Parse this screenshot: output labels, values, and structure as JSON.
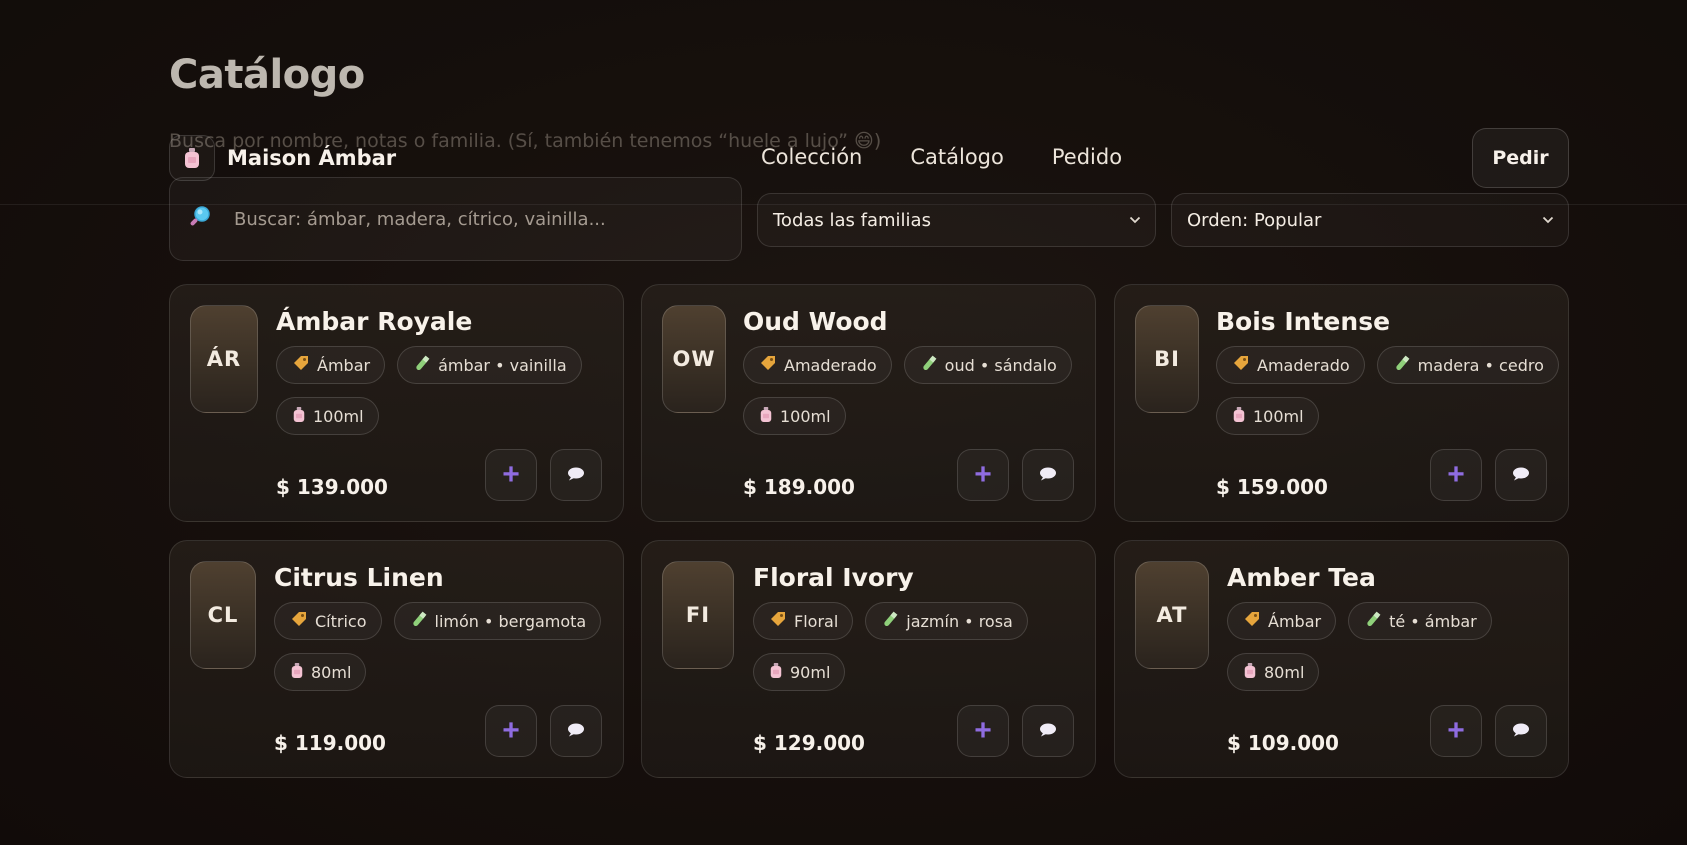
{
  "page": {
    "title": "Catálogo",
    "subtitle": "Busca por nombre, notas o familia. (Sí, también tenemos “huele a lujo” 😄)"
  },
  "nav": {
    "brand": "Maison Ámbar",
    "links": [
      "Colección",
      "Catálogo",
      "Pedido"
    ],
    "cta": "Pedir"
  },
  "filters": {
    "search_placeholder": "Buscar: ámbar, madera, cítrico, vainilla...",
    "family_select": "Todas las familias",
    "order_select": "Orden: Popular"
  },
  "products": [
    {
      "initials": "ÁR",
      "name": "Ámbar Royale",
      "family": "Ámbar",
      "notes": "ámbar • vainilla",
      "size": "100ml",
      "price": "$ 139.000"
    },
    {
      "initials": "OW",
      "name": "Oud Wood",
      "family": "Amaderado",
      "notes": "oud • sándalo",
      "size": "100ml",
      "price": "$ 189.000"
    },
    {
      "initials": "BI",
      "name": "Bois Intense",
      "family": "Amaderado",
      "notes": "madera • cedro",
      "size": "100ml",
      "price": "$ 159.000"
    },
    {
      "initials": "CL",
      "name": "Citrus Linen",
      "family": "Cítrico",
      "notes": "limón • bergamota",
      "size": "80ml",
      "price": "$ 119.000"
    },
    {
      "initials": "FI",
      "name": "Floral Ivory",
      "family": "Floral",
      "notes": "jazmín • rosa",
      "size": "90ml",
      "price": "$ 129.000"
    },
    {
      "initials": "AT",
      "name": "Amber Tea",
      "family": "Ámbar",
      "notes": "té • ámbar",
      "size": "80ml",
      "price": "$ 109.000"
    }
  ],
  "colors": {
    "accent": "#8f6ce0",
    "background": "#140e0b"
  }
}
